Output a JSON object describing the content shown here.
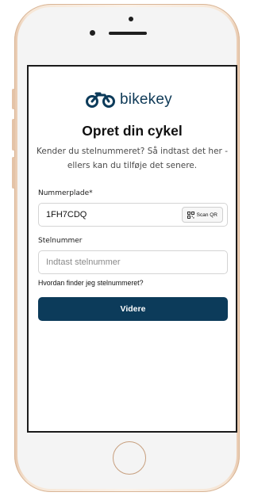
{
  "brand": {
    "logo_text_bike": "bike",
    "logo_text_key": "key",
    "accent": "#0c3b5a"
  },
  "page": {
    "title": "Opret din cykel",
    "subtitle": "Kender du stelnummeret? Så indtast det her - ellers kan du tilføje det senere."
  },
  "form": {
    "plate_label": "Nummerplade*",
    "plate_value": "1FH7CDQ",
    "scan_label": "Scan QR",
    "frame_label": "Stelnummer",
    "frame_placeholder": "Indtast stelnummer",
    "frame_value": "",
    "help_link": "Hvordan finder jeg stelnummeret?",
    "submit_label": "Videre"
  },
  "icons": {
    "logo": "bicycle-logo-icon",
    "scan": "qr-code-icon"
  }
}
